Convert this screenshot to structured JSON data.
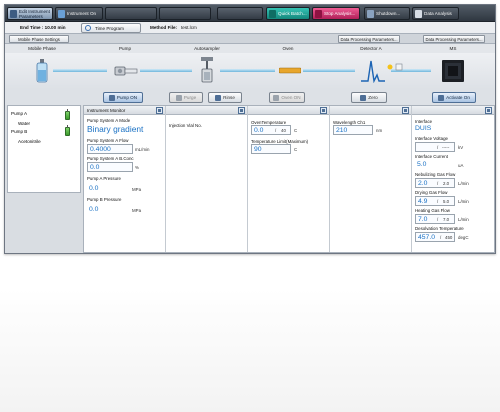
{
  "toolbar": {
    "edit_instrument": "Edit Instrument Parameters",
    "instrument_on": "Instrument On",
    "quick_batch": "Quick Batch...",
    "stop_analysis": "Stop Analysis...",
    "shutdown": "Shutdown...",
    "data_analysis": "Data Analysis",
    "colors": {
      "teal": "#1fa798",
      "pink": "#d63a78",
      "active": "#a9bdd4"
    }
  },
  "infobar": {
    "end_time_label": "End Time : 10.00 min",
    "time_program": "Time Program",
    "method_file_label": "Method File:",
    "method_file_value": "test.lcm"
  },
  "settings": {
    "mobile_phase_settings": "Mobile Phase Settings",
    "dpp_detector": "Data Processing Parameters...",
    "dpp_ms": "Data Processing Parameters..."
  },
  "modules": {
    "mobile_phase": "Mobile Phase",
    "pump": "Pump",
    "autosampler": "Autosampler",
    "oven": "Oven",
    "detector": "Detector A",
    "ms": "MS"
  },
  "buttons": {
    "pump_on": "Pump ON",
    "purge": "Purge",
    "rinse": "Rinse",
    "oven_on": "Oven ON",
    "zero": "Zero",
    "activate_on": "Activate On"
  },
  "mobile_phase": {
    "pump_a": "Pump A",
    "solvent_a": "Water",
    "pump_b": "Pump B",
    "solvent_b": "Acetonitrile"
  },
  "monitor": {
    "title": "Instrument Monitor",
    "pump": {
      "mode_label": "Pump System A Mode",
      "mode_value": "Binary gradient",
      "flow_label": "Pump System A Flow",
      "flow_value": "0.4000",
      "flow_unit": "mL/min",
      "bconc_label": "Pump System A B.Conc",
      "bconc_value": "0.0",
      "bconc_unit": "%",
      "pa_pressure_label": "Pump A Pressure",
      "pa_pressure_value": "0.0",
      "pa_pressure_unit": "MPa",
      "pb_pressure_label": "Pump B Pressure",
      "pb_pressure_value": "0.0",
      "pb_pressure_unit": "MPa"
    },
    "autosampler": {
      "vial_label": "Injection Vial No."
    },
    "oven": {
      "temp_label": "OvenTemperature",
      "temp_value": "0.0",
      "temp_sep": "/",
      "temp_max": "40",
      "temp_unit": "C",
      "limit_label": "Temperature Limit(Maximum)",
      "limit_value": "90",
      "limit_unit": "C"
    },
    "detector": {
      "wavelength_label": "Wavelength Ch1",
      "wavelength_value": "210",
      "wavelength_unit": "nm"
    },
    "ms": {
      "interface_label": "Interface",
      "interface_value": "DUIS",
      "voltage_label": "Interface Voltage",
      "voltage_sep": "/",
      "voltage_set": "-----",
      "voltage_unit": "kV",
      "current_label": "Interface Current",
      "current_value": "5.0",
      "current_unit": "uA",
      "neb_label": "Nebulizing Gas Flow",
      "neb_value": "2.0",
      "neb_sep": "/",
      "neb_set": "2.0",
      "neb_unit": "L/min",
      "drying_label": "Drying Gas Flow",
      "drying_value": "4.9",
      "drying_sep": "/",
      "drying_set": "5.0",
      "drying_unit": "L/min",
      "heating_label": "Heating Gas Flow",
      "heating_value": "7.0",
      "heating_sep": "/",
      "heating_set": "7.0",
      "heating_unit": "L/min",
      "desolv_label": "Desolvation Temperature",
      "desolv_value": "457.0",
      "desolv_sep": "/",
      "desolv_set": "450",
      "desolv_unit": "degC"
    }
  }
}
